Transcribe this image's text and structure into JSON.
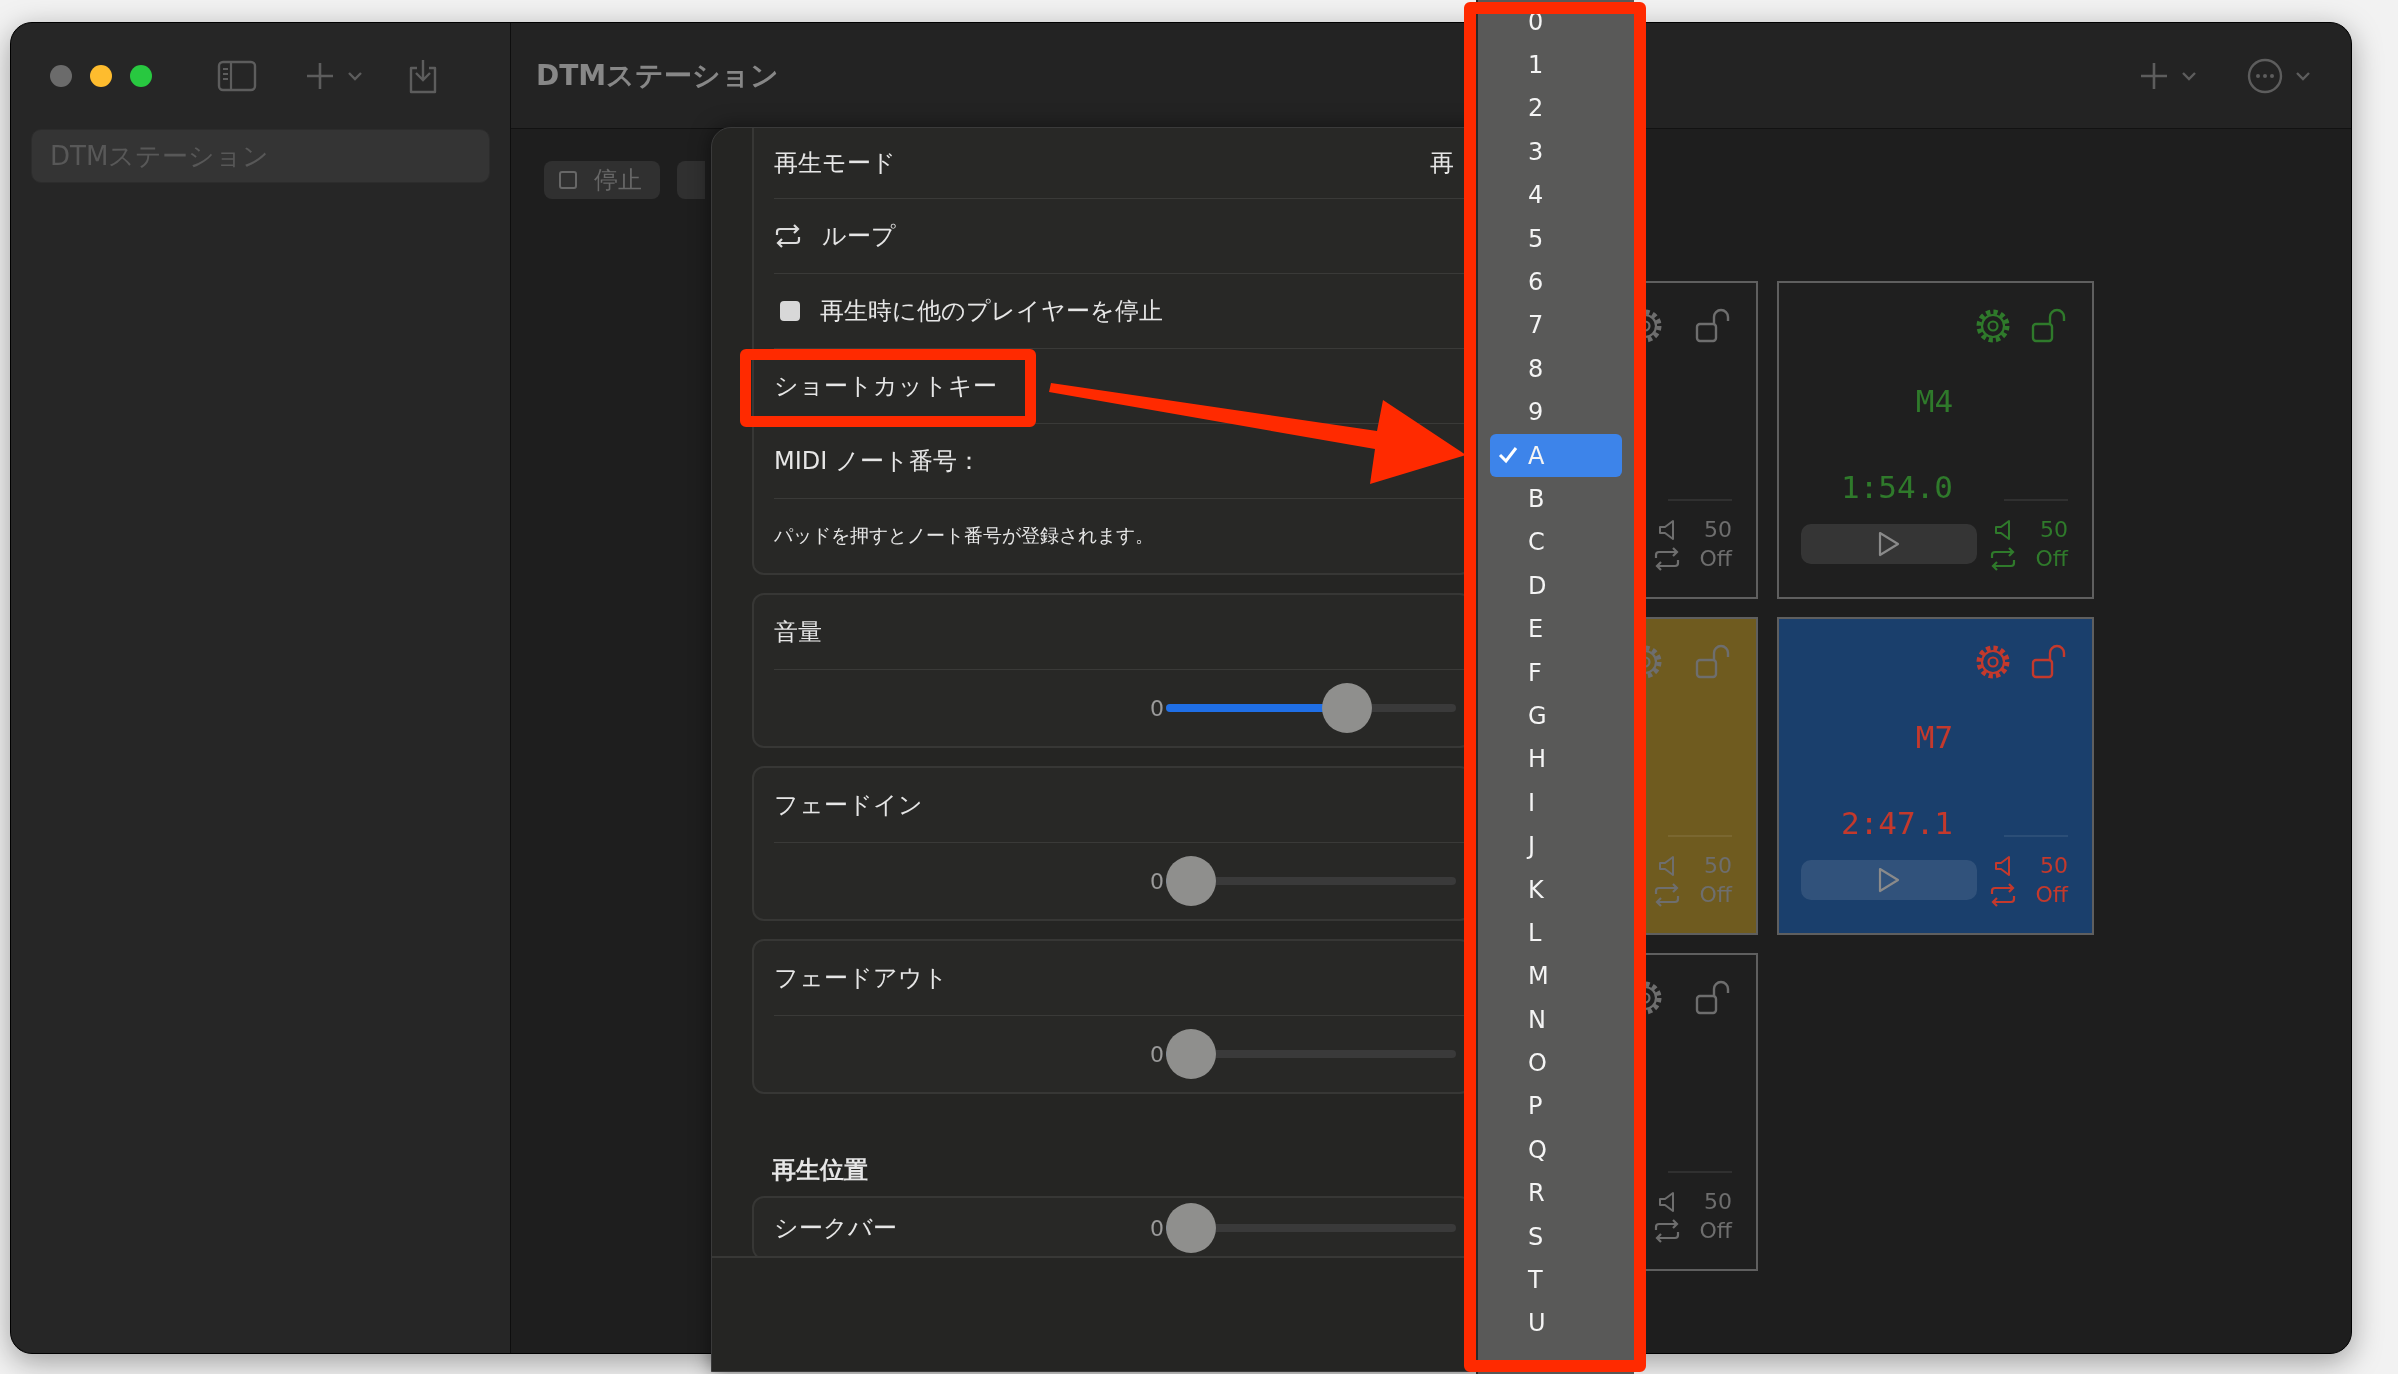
{
  "window": {
    "title": "DTMステーション"
  },
  "sidebar": {
    "items": [
      {
        "label": "DTMステーション",
        "selected": true
      }
    ]
  },
  "toolbar": {
    "buttons": [
      {
        "label": "停止"
      }
    ]
  },
  "sheet": {
    "playback_mode": {
      "label": "再生モード",
      "value": "再"
    },
    "loop": {
      "label": "ループ"
    },
    "stop_others": {
      "label": "再生時に他のプレイヤーを停止",
      "checked": false
    },
    "shortcut": {
      "label": "ショートカットキー"
    },
    "midi": {
      "label": "MIDI ノート番号：",
      "note": "パッドを押すとノート番号が登録されます。"
    },
    "sliders": [
      {
        "label": "音量",
        "min": "0",
        "level": 0.65
      },
      {
        "label": "フェードイン",
        "min": "0",
        "level": 0
      },
      {
        "label": "フェードアウト",
        "min": "0",
        "level": 0
      }
    ],
    "position": {
      "heading": "再生位置",
      "seek": {
        "label": "シークバー",
        "min": "0",
        "level": 0
      }
    }
  },
  "pads": [
    {
      "kind": "inactive",
      "color": "#1f1f1f",
      "volume": "50",
      "loop": "Off"
    },
    {
      "kind": "active",
      "name": "M4",
      "time": "1:54.0",
      "color": "#1f1f1f",
      "volume": "50",
      "loop": "Off"
    },
    {
      "kind": "inactive",
      "color": "#6f5b1f",
      "volume": "50",
      "loop": "Off"
    },
    {
      "kind": "armed",
      "name": "M7",
      "time": "2:47.1",
      "color": "#1a3f6c",
      "volume": "50",
      "loop": "Off"
    },
    {
      "kind": "inactive",
      "color": "#1f1f1f",
      "volume": "50",
      "loop": "Off"
    }
  ],
  "key_menu": {
    "items": [
      {
        "label": "0",
        "selected": false
      },
      {
        "label": "1",
        "selected": false
      },
      {
        "label": "2",
        "selected": false
      },
      {
        "label": "3",
        "selected": false
      },
      {
        "label": "4",
        "selected": false
      },
      {
        "label": "5",
        "selected": false
      },
      {
        "label": "6",
        "selected": false
      },
      {
        "label": "7",
        "selected": false
      },
      {
        "label": "8",
        "selected": false
      },
      {
        "label": "9",
        "selected": false
      },
      {
        "label": "A",
        "selected": true
      },
      {
        "label": "B",
        "selected": false
      },
      {
        "label": "C",
        "selected": false
      },
      {
        "label": "D",
        "selected": false
      },
      {
        "label": "E",
        "selected": false
      },
      {
        "label": "F",
        "selected": false
      },
      {
        "label": "G",
        "selected": false
      },
      {
        "label": "H",
        "selected": false
      },
      {
        "label": "I",
        "selected": false
      },
      {
        "label": "J",
        "selected": false
      },
      {
        "label": "K",
        "selected": false
      },
      {
        "label": "L",
        "selected": false
      },
      {
        "label": "M",
        "selected": false
      },
      {
        "label": "N",
        "selected": false
      },
      {
        "label": "O",
        "selected": false
      },
      {
        "label": "P",
        "selected": false
      },
      {
        "label": "Q",
        "selected": false
      },
      {
        "label": "R",
        "selected": false
      },
      {
        "label": "S",
        "selected": false
      },
      {
        "label": "T",
        "selected": false
      },
      {
        "label": "U",
        "selected": false
      }
    ]
  }
}
